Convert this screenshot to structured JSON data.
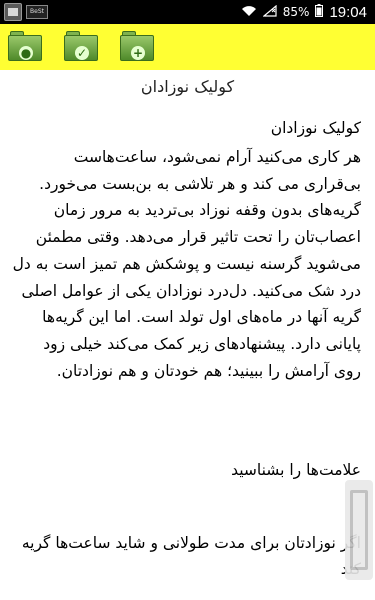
{
  "status_bar": {
    "battery": "85%",
    "time": "19:04",
    "badge_text": "BeSt"
  },
  "toolbar": {
    "bg_color": "#ffff33",
    "buttons": [
      {
        "icon": "folder-bookmark-icon",
        "symbol": "●"
      },
      {
        "icon": "folder-check-icon",
        "symbol": "✓"
      },
      {
        "icon": "folder-add-icon",
        "symbol": "+"
      }
    ]
  },
  "page": {
    "title": "کولیک نوزادان"
  },
  "article": {
    "heading": "کولیک نوزادان",
    "paragraph1": "هر کاری می‌کنید آرام نمی‌شود، ساعت‌هاست بی‌قراری می کند و هر تلاشی به بن‌بست می‌خورد. گریه‌های بدون وقفه نوزاد بی‌تردید به مرور زمان اعصاب‌تان را تحت تاثیر قرار می‌دهد. وقتی مطمئن می‌شوید گرسنه نیست و پوشکش هم تمیز است به دل درد شک می‌کنید. دل‌درد نوزادان یکی از عوامل اصلی گریه آنها در ماه‌های اول تولد است. اما این گریه‌ها پایانی دارد. پیشنهادهای زیر کمک می‌کند خیلی زود روی آرامش را ببینید؛ هم خودتان و هم نوزادتان.",
    "section_title": "علامت‌ها را بشناسید",
    "paragraph2": "اگر نوزادتان برای مدت طولانی و شاید ساعت‌ها گریه کند"
  }
}
